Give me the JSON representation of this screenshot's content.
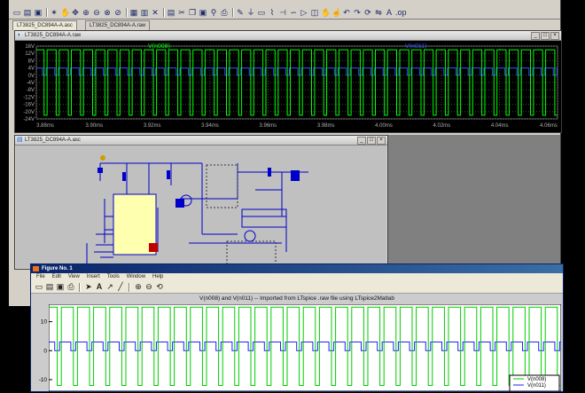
{
  "ltspice": {
    "tabs": [
      "LT3825_DC894A-A.asc",
      "LT3825_DC894A-A.raw"
    ],
    "plot_window": {
      "title": "LT3825_DC894A-A.raw",
      "trace_labels": [
        "V(n008)",
        "V(n011)"
      ],
      "colors": {
        "n008": "#00ff00",
        "n011": "#3050ff",
        "grid": "#404040",
        "axis_text": "#b0b0b0"
      }
    },
    "schematic_window": {
      "title": "LT3825_DC894A-A.asc"
    }
  },
  "matlab": {
    "title": "Figure No. 1",
    "menu": [
      "File",
      "Edit",
      "View",
      "Insert",
      "Tools",
      "Window",
      "Help"
    ],
    "heading": "V(n008) and V(n011) -- Imported from LTspice .raw file using LTspice2Matlab",
    "legend": [
      "V(n008)",
      "V(n011)"
    ],
    "colors": {
      "n008": "#00cc00",
      "n011": "#2020ff"
    }
  },
  "chart_data": [
    {
      "type": "line",
      "x_ticks": [
        "3.88ms",
        "3.90ms",
        "3.92ms",
        "3.94ms",
        "3.96ms",
        "3.98ms",
        "4.00ms",
        "4.02ms",
        "4.04ms",
        "4.06ms"
      ],
      "y_ticks": [
        "16V",
        "12V",
        "8V",
        "4V",
        "0V",
        "-4V",
        "-8V",
        "-12V",
        "-16V",
        "-20V",
        "-24V"
      ],
      "xlim": [
        3.88,
        4.06
      ],
      "ylim": [
        -24,
        16
      ],
      "grid": true,
      "series": [
        {
          "name": "V(n008)",
          "shape": "square pulse",
          "high": 14,
          "low": -22,
          "period": 0.0042
        },
        {
          "name": "V(n011)",
          "shape": "square pulse",
          "high": 4,
          "low": 0,
          "period": 0.0042
        }
      ]
    },
    {
      "type": "line",
      "y_ticks": [
        "10",
        "0",
        "-10"
      ],
      "ylim": [
        -14,
        16
      ],
      "legend": "bottom-right",
      "series": [
        {
          "name": "V(n008)",
          "shape": "square pulse",
          "high": 15,
          "low": -12
        },
        {
          "name": "V(n011)",
          "shape": "square pulse",
          "high": 3,
          "low": 0
        }
      ]
    }
  ]
}
